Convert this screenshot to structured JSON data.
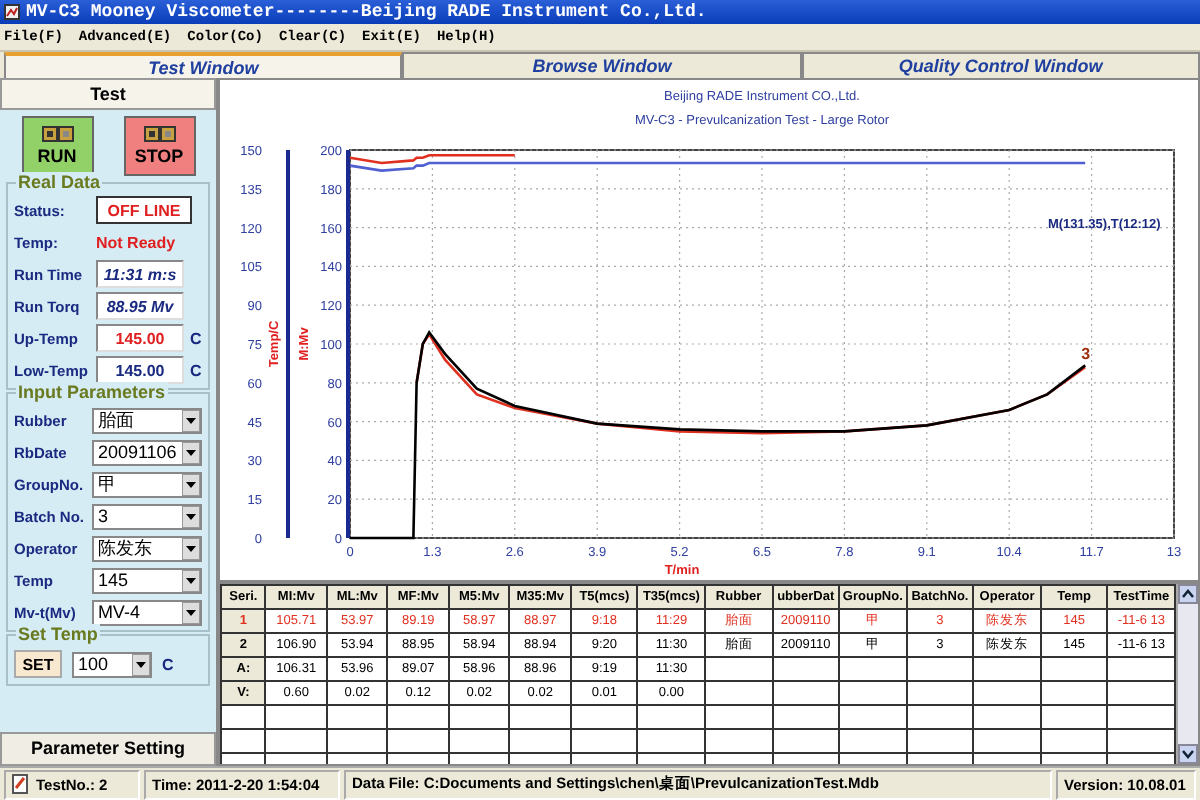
{
  "window": {
    "title": "MV-C3 Mooney Viscometer--------Beijing RADE Instrument Co.,Ltd."
  },
  "menu": [
    "File(F)",
    "Advanced(E)",
    "Color(Co)",
    "Clear(C)",
    "Exit(E)",
    "Help(H)"
  ],
  "tabs": [
    {
      "label": "Test Window",
      "selected": true
    },
    {
      "label": "Browse Window",
      "selected": false
    },
    {
      "label": "Quality Control Window",
      "selected": false
    }
  ],
  "left_panel": {
    "header": "Test",
    "buttons": [
      {
        "label": "RUN",
        "kind": "run"
      },
      {
        "label": "STOP",
        "kind": "stop"
      }
    ],
    "real_data": {
      "title": "Real Data",
      "status_label": "Status:",
      "status": "OFF LINE",
      "temp_label": "Temp:",
      "temp": "Not Ready",
      "readings": [
        {
          "label": "Run Time",
          "value": "11:31 m:s",
          "kind": "italic"
        },
        {
          "label": "Run Torq",
          "value": "88.95 Mv",
          "kind": "italic"
        },
        {
          "label": "Up-Temp",
          "value": "145.00",
          "unit": "C",
          "kind": "hot"
        },
        {
          "label": "Low-Temp",
          "value": "145.00",
          "unit": "C",
          "kind": "cold"
        }
      ]
    },
    "input_parameters": {
      "title": "Input Parameters",
      "fields": [
        {
          "label": "Rubber",
          "value": "胎面"
        },
        {
          "label": "RbDate",
          "value": "20091106"
        },
        {
          "label": "GroupNo.",
          "value": "甲"
        },
        {
          "label": "Batch No.",
          "value": "3"
        },
        {
          "label": "Operator",
          "value": "陈发东"
        },
        {
          "label": "Temp",
          "value": "145"
        },
        {
          "label": "Mv-t(Mv)",
          "value": "MV-4"
        }
      ]
    },
    "set_temp": {
      "title": "Set Temp",
      "button": "SET",
      "value": "100",
      "unit": "C"
    },
    "bottom_tab": "Parameter Setting"
  },
  "chart": {
    "chart_data": {
      "type": "line",
      "title": "Beijing RADE Instrument CO.,Ltd.",
      "subtitle": "MV-C3 - Prevulcanization Test - Large Rotor",
      "xlabel": "T/min",
      "ylabel": "M:Mv",
      "x": [
        0,
        0.5,
        1.0,
        1.05,
        1.15,
        1.25,
        1.5,
        2.0,
        2.6,
        3.9,
        5.2,
        6.5,
        7.8,
        9.1,
        10.4,
        11.0,
        11.6
      ],
      "series": [
        {
          "color": "#e03020",
          "values": [
            null,
            null,
            null,
            80,
            100,
            105,
            92,
            74,
            67,
            59,
            55,
            54,
            55,
            58,
            66,
            74,
            88
          ]
        },
        {
          "color": "#000000",
          "values": [
            0,
            0,
            0,
            80,
            100,
            106,
            95,
            77,
            68,
            59,
            56,
            55,
            55,
            58,
            66,
            74,
            89
          ]
        },
        {
          "color": "#e03020",
          "axis": "y2",
          "values": [
            147,
            145,
            146,
            147,
            147,
            148,
            148,
            148,
            148,
            null,
            null,
            null,
            null,
            null,
            null,
            null,
            null
          ]
        },
        {
          "color": "#5060d0",
          "axis": "y2",
          "values": [
            144,
            142,
            143,
            144,
            144,
            145,
            145,
            145,
            145,
            145,
            145,
            145,
            145,
            145,
            145,
            145,
            145
          ]
        }
      ],
      "grid": true,
      "xlim": [
        0,
        13
      ],
      "ylim": [
        0,
        200
      ],
      "xticks": [
        0,
        1.3,
        2.6,
        3.9,
        5.2,
        6.5,
        7.8,
        9.1,
        10.4,
        11.7,
        13
      ],
      "yticks": [
        0,
        20,
        40,
        60,
        80,
        100,
        120,
        140,
        160,
        180,
        200
      ],
      "annotations": [
        "M(131.35),T(12:12)",
        "3"
      ],
      "y2label": "Temp/C",
      "y2lim": [
        0,
        150
      ],
      "y2ticks": [
        0,
        15,
        30,
        45,
        60,
        75,
        90,
        105,
        120,
        135,
        150
      ]
    }
  },
  "table": {
    "columns": [
      "Seri.",
      "MI:Mv",
      "ML:Mv",
      "MF:Mv",
      "M5:Mv",
      "M35:Mv",
      "T5(mcs)",
      "T35(mcs)",
      "Rubber",
      "ubberDat",
      "GroupNo.",
      "BatchNo.",
      "Operator",
      "Temp",
      "TestTime"
    ],
    "rows": [
      {
        "color": "#e03020",
        "cells": [
          "1",
          "105.71",
          "53.97",
          "89.19",
          "58.97",
          "88.97",
          "9:18",
          "11:29",
          "胎面",
          "2009110",
          "甲",
          "3",
          "陈发东",
          "145",
          "-11-6 13"
        ]
      },
      {
        "color": "#000000",
        "cells": [
          "2",
          "106.90",
          "53.94",
          "88.95",
          "58.94",
          "88.94",
          "9:20",
          "11:30",
          "胎面",
          "2009110",
          "甲",
          "3",
          "陈发东",
          "145",
          "-11-6 13"
        ]
      },
      {
        "color": "#000000",
        "cells": [
          "A:",
          "106.31",
          "53.96",
          "89.07",
          "58.96",
          "88.96",
          "9:19",
          "11:30"
        ]
      },
      {
        "color": "#000000",
        "cells": [
          "V:",
          "0.60",
          "0.02",
          "0.12",
          "0.02",
          "0.02",
          "0.01",
          "0.00"
        ]
      }
    ]
  },
  "status_bar": {
    "test_no": "TestNo.: 2",
    "time": "Time: 2011-2-20 1:54:04",
    "data_file": "Data File: C:Documents and Settings\\chen\\桌面\\PrevulcanizationTest.Mdb",
    "version": "Version: 10.08.01"
  }
}
